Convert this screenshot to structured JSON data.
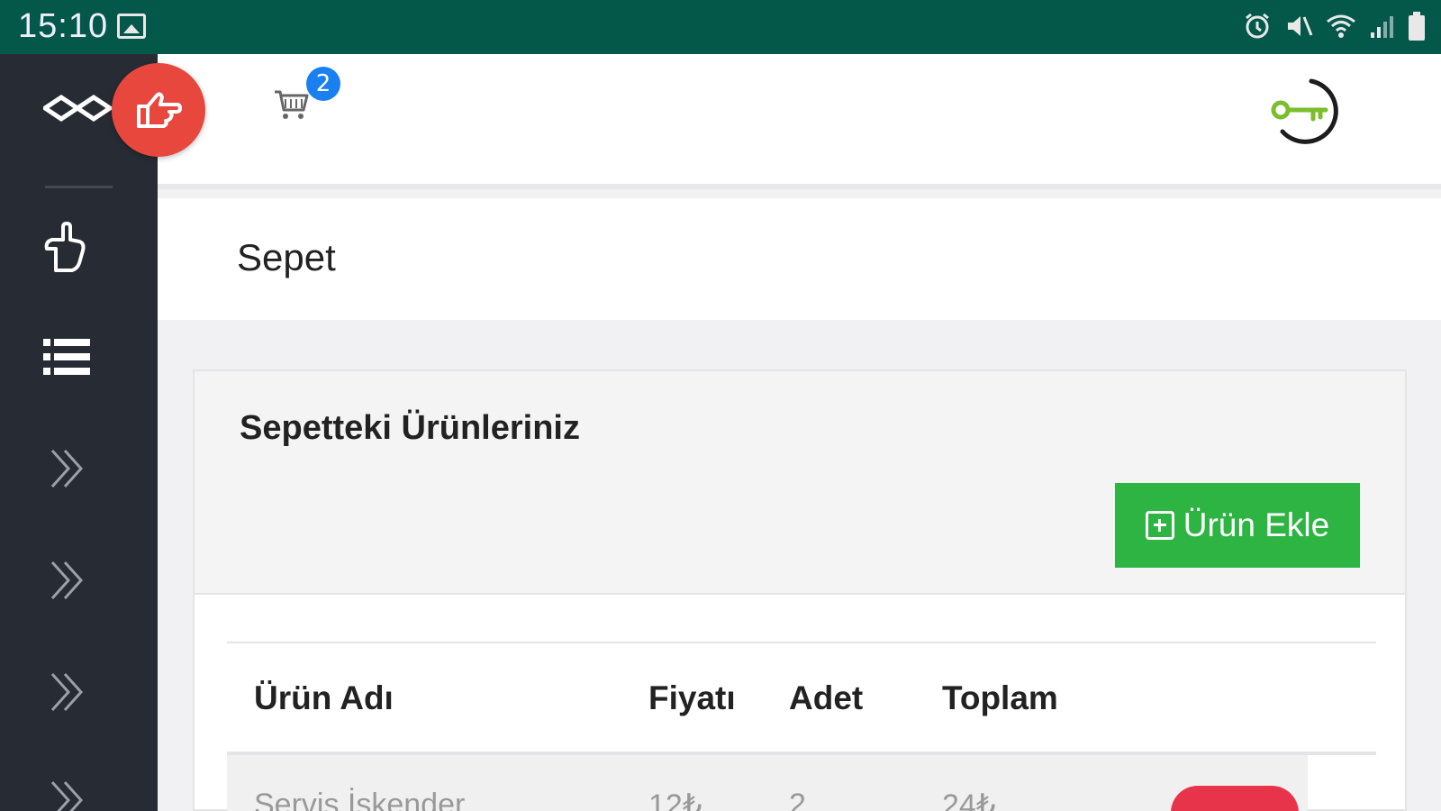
{
  "status_bar": {
    "time": "15:10",
    "icons": [
      "gallery-icon",
      "alarm-icon",
      "mute-icon",
      "wifi-icon",
      "signal-icon",
      "battery-icon"
    ]
  },
  "sidebar": {
    "items": [
      {
        "icon": "logo-icon"
      },
      {
        "icon": "hand-pointer-icon"
      },
      {
        "icon": "list-icon"
      },
      {
        "icon": "double-chevron-right-icon"
      },
      {
        "icon": "double-chevron-right-icon"
      },
      {
        "icon": "double-chevron-right-icon"
      },
      {
        "icon": "double-chevron-right-icon"
      }
    ]
  },
  "header": {
    "cart_count": "2",
    "logout_icon": "key-logout-icon"
  },
  "page": {
    "title": "Sepet"
  },
  "card": {
    "title": "Sepetteki Ürünleriniz",
    "add_button_label": "Ürün Ekle"
  },
  "table": {
    "columns": [
      "Ürün Adı",
      "Fiyatı",
      "Adet",
      "Toplam"
    ],
    "rows": [
      {
        "name": "Servis İskender",
        "price": "12₺",
        "qty": "2",
        "total": "24₺"
      }
    ]
  },
  "colors": {
    "status_bar": "#03584a",
    "sidebar": "#272b33",
    "fab": "#e8473d",
    "cart_badge": "#1a7ff0",
    "add_button": "#2db443",
    "delete_button": "#e8344a",
    "key_icon": "#7bbd2a"
  }
}
